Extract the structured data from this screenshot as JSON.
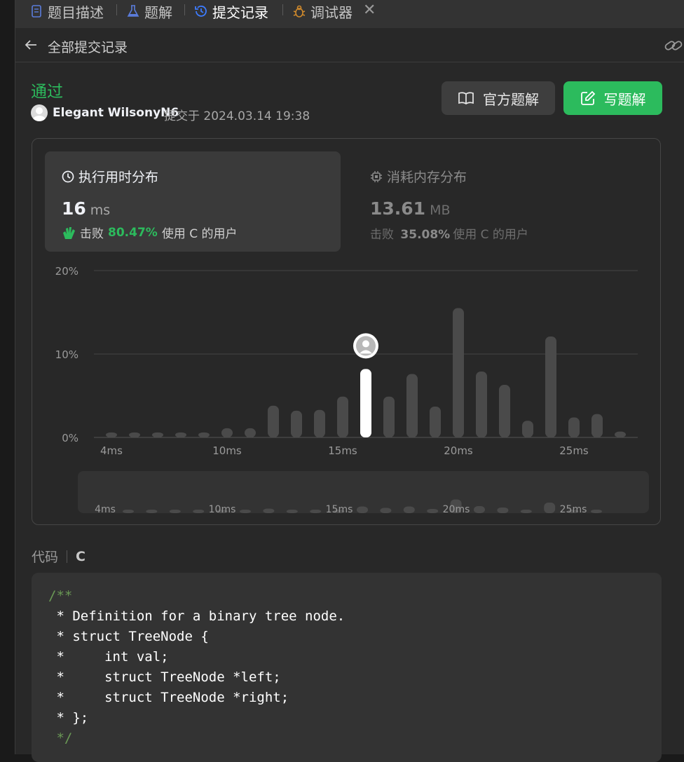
{
  "tabs": [
    {
      "label": "题目描述",
      "icon": "description-icon"
    },
    {
      "label": "题解",
      "icon": "flask-icon"
    },
    {
      "label": "提交记录",
      "icon": "history-icon",
      "active": true
    },
    {
      "label": "调试器",
      "icon": "bug-icon"
    }
  ],
  "subheader": {
    "title": "全部提交记录"
  },
  "submission": {
    "status": "通过",
    "user": "Elegant WilsonyN6",
    "submitted_text": "提交于 2024.03.14 19:38"
  },
  "buttons": {
    "official": "官方题解",
    "write": "写题解"
  },
  "runtime": {
    "title": "执行用时分布",
    "value": "16",
    "unit": "ms",
    "beats_prefix": "击败",
    "beats_pct": "80.47%",
    "beats_suffix": "使用 C 的用户"
  },
  "memory": {
    "title": "消耗内存分布",
    "value": "13.61",
    "unit": "MB",
    "beats_prefix": "击败",
    "beats_pct": "35.08%",
    "beats_suffix": "使用 C 的用户"
  },
  "chart_data": {
    "type": "bar",
    "y_ticks": [
      "0%",
      "10%",
      "20%"
    ],
    "ylim": [
      0,
      20
    ],
    "x_tick_labels": [
      "4ms",
      "10ms",
      "15ms",
      "20ms",
      "25ms"
    ],
    "x_tick_values": [
      4,
      9,
      14,
      19,
      24
    ],
    "x": [
      4,
      5,
      6,
      7,
      8,
      9,
      10,
      11,
      12,
      13,
      14,
      15,
      16,
      17,
      18,
      19,
      20,
      21,
      22,
      23,
      24,
      25,
      26
    ],
    "values": [
      0.6,
      0.6,
      0.6,
      0.6,
      0.6,
      1.1,
      1.1,
      3.8,
      3.2,
      3.3,
      4.9,
      8.2,
      4.9,
      7.6,
      3.7,
      15.5,
      7.9,
      6.3,
      2.0,
      12.1,
      2.4,
      2.8,
      0.7
    ],
    "highlight_x": 15,
    "overview_values": [
      0.6,
      0.6,
      0.6,
      0.6,
      0.6,
      0.6,
      0.9,
      0.6,
      0.6,
      0.6,
      1.5,
      1.1,
      1.5,
      0.8,
      3.5,
      1.6,
      1.2,
      0.6,
      2.6,
      0.6,
      0.6
    ]
  },
  "code": {
    "label": "代码",
    "language": "C",
    "lines": [
      {
        "text": "/**",
        "comment": true
      },
      {
        "text": " * Definition for a binary tree node.",
        "comment": false
      },
      {
        "text": " * struct TreeNode {",
        "comment": false
      },
      {
        "text": " *     int val;",
        "comment": false
      },
      {
        "text": " *     struct TreeNode *left;",
        "comment": false
      },
      {
        "text": " *     struct TreeNode *right;",
        "comment": false
      },
      {
        "text": " * };",
        "comment": false
      },
      {
        "text": " */",
        "comment": true
      }
    ]
  },
  "colors": {
    "accent_green": "#2cbb5d",
    "bar": "#4a4a4a",
    "bar_highlight": "#ffffff"
  }
}
